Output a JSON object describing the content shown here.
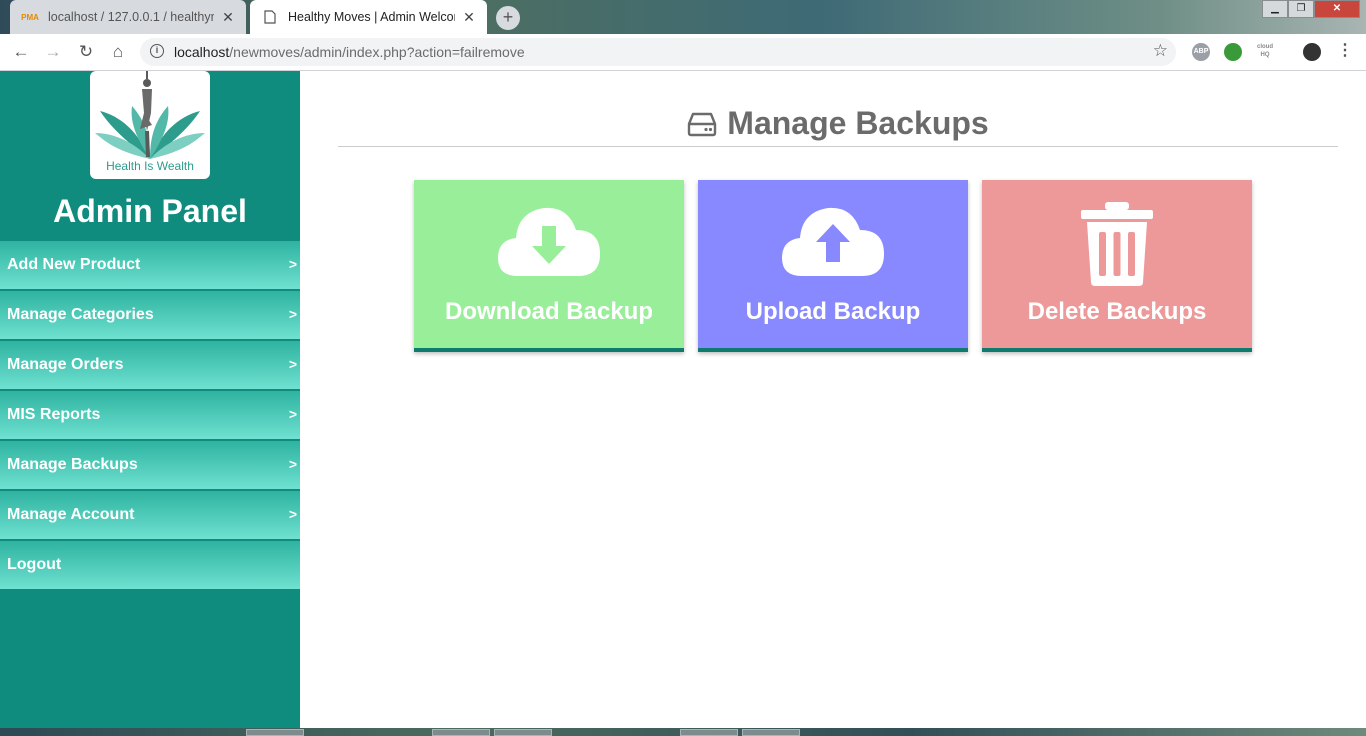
{
  "browser": {
    "tabs": [
      {
        "title": "localhost / 127.0.0.1 / healthymo",
        "favicon": "PMA",
        "active": false
      },
      {
        "title": "Healthy Moves | Admin Welcome",
        "active": true
      }
    ],
    "url_host": "localhost",
    "url_path": "/newmoves/admin/index.php?action=failremove",
    "extensions": [
      "ABP",
      "cloud HQ"
    ]
  },
  "sidebar": {
    "logo_caption": "Health Is Wealth",
    "title": "Admin Panel",
    "items": [
      {
        "label": "Add New Product",
        "arrow": ">"
      },
      {
        "label": "Manage Categories",
        "arrow": ">"
      },
      {
        "label": "Manage Orders",
        "arrow": ">"
      },
      {
        "label": "MIS Reports",
        "arrow": ">"
      },
      {
        "label": "Manage Backups",
        "arrow": ">"
      },
      {
        "label": "Manage Account",
        "arrow": ">"
      },
      {
        "label": "Logout",
        "arrow": ""
      }
    ]
  },
  "main": {
    "title": "Manage Backups",
    "title_icon": "hdd-icon",
    "cards": [
      {
        "label": "Download Backup",
        "icon": "cloud-download-icon",
        "color": "#99ee99"
      },
      {
        "label": "Upload Backup",
        "icon": "cloud-upload-icon",
        "color": "#8888ff"
      },
      {
        "label": "Delete Backups",
        "icon": "trash-icon",
        "color": "#ee9999"
      }
    ]
  },
  "colors": {
    "sidebar_bg": "#0f8c7e",
    "menu_gradient_top": "#2fb3a0",
    "menu_gradient_bottom": "#6fe1d1",
    "title_grey": "#6b6b6b"
  }
}
